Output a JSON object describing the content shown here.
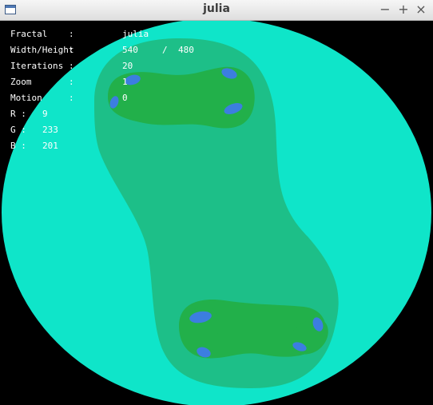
{
  "window": {
    "title": "julia"
  },
  "controls": {
    "minimize_symbol": "−",
    "maximize_symbol": "+",
    "close_symbol": "×"
  },
  "info": {
    "fractal_label": "Fractal",
    "fractal_colon": ":",
    "fractal_value": "julia",
    "size_label": "Width/Height",
    "size_colon": ":",
    "width_value": "540",
    "size_separator": "/",
    "height_value": "480",
    "iterations_label": "Iterations",
    "iterations_colon": ":",
    "iterations_value": "20",
    "zoom_label": "Zoom",
    "zoom_colon": ":",
    "zoom_value": "1",
    "motion_label": "Motion",
    "motion_colon": ":",
    "motion_value": "0",
    "r_label": "R :",
    "r_value": "9",
    "g_label": "G :",
    "g_value": "233",
    "b_label": "B :",
    "b_value": "201"
  },
  "colors": {
    "outer": "#0fe5c9",
    "band1": "#1dbf88",
    "band2": "#22b04a",
    "core": "#3c7ee0"
  }
}
